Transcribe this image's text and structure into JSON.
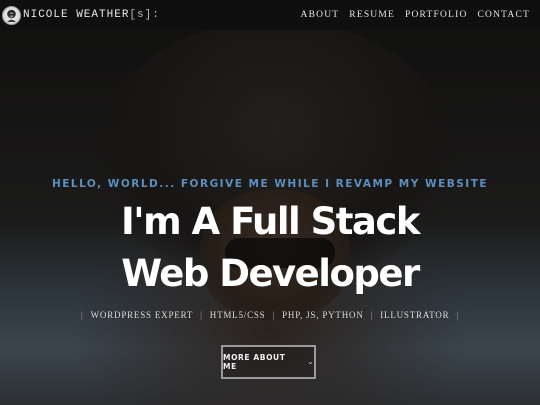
{
  "brand": {
    "name": "NICOLE WEATHER",
    "suffix": "[s]:",
    "logo_icon": "portrait-logo-icon"
  },
  "nav": {
    "items": [
      {
        "label": "ABOUT"
      },
      {
        "label": "RESUME"
      },
      {
        "label": "PORTFOLIO"
      },
      {
        "label": "CONTACT"
      }
    ]
  },
  "hero": {
    "tagline": "HELLO, WORLD... FORGIVE ME WHILE I REVAMP MY WEBSITE",
    "headline_line1": "I'm A Full Stack",
    "headline_line2": "Web Developer",
    "skills": [
      {
        "label": "WORDPRESS EXPERT"
      },
      {
        "label": "HTML5/CSS"
      },
      {
        "label": "PHP, JS, PYTHON"
      },
      {
        "label": "ILLUSTRATOR"
      }
    ],
    "cta_label": "MORE ABOUT ME",
    "cta_icon": "chevron-down-icon"
  },
  "colors": {
    "tagline": "#5b8fbe",
    "headline": "#ffffff",
    "navbar_bg": "#0f0f0f"
  }
}
